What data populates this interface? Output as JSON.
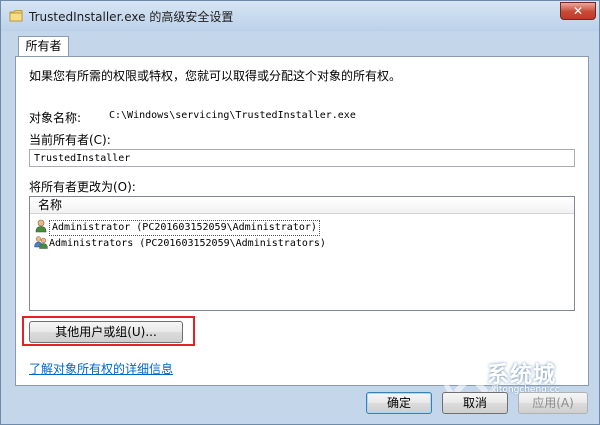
{
  "window": {
    "title": "TrustedInstaller.exe 的高级安全设置",
    "close_label": "✕"
  },
  "tabs": [
    {
      "label": "所有者"
    }
  ],
  "panel": {
    "instruction": "如果您有所需的权限或特权，您就可以取得或分配这个对象的所有权。",
    "object_name_label": "对象名称:",
    "object_name_value": "C:\\Windows\\servicing\\TrustedInstaller.exe",
    "current_owner_label": "当前所有者(C):",
    "current_owner_value": "TrustedInstaller",
    "change_owner_label": "将所有者更改为(O):",
    "list": {
      "column_header": "名称",
      "rows": [
        {
          "text": "Administrator (PC201603152059\\Administrator)",
          "icon": "user-icon",
          "selected": true
        },
        {
          "text": "Administrators (PC201603152059\\Administrators)",
          "icon": "group-icon",
          "selected": false
        }
      ]
    },
    "other_users_button": "其他用户或组(U)...",
    "learn_more_link": "了解对象所有权的详细信息"
  },
  "footer": {
    "ok": "确定",
    "cancel": "取消",
    "apply": "应用(A)"
  },
  "watermark": {
    "text": "系统城",
    "sub": "xitongcheng.cc"
  },
  "colors": {
    "highlight": "#e32323",
    "link": "#0066cc"
  }
}
